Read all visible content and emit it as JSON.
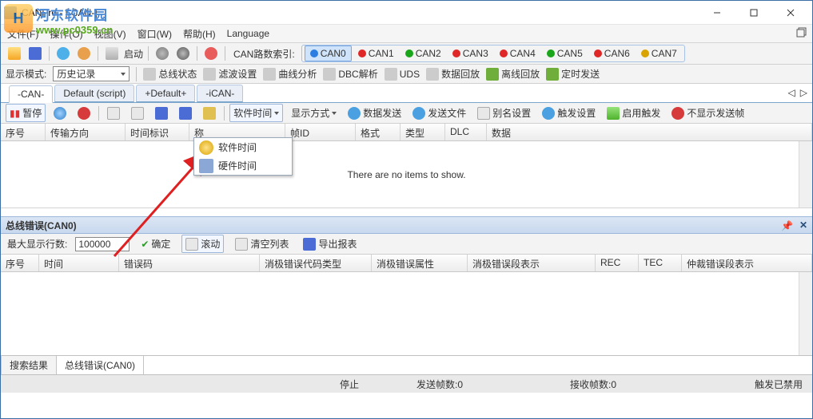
{
  "window": {
    "title": "CANPro - [-CAN-]"
  },
  "watermark": {
    "cn": "河东软件园",
    "url": "www.pc0359.cn",
    "logo_text": "H"
  },
  "menubar": [
    "文件(F)",
    "操作(O)",
    "视图(V)",
    "窗口(W)",
    "帮助(H)",
    "Language"
  ],
  "toolbar1": {
    "route_label": "CAN路数索引:",
    "routes": [
      {
        "label": "CAN0",
        "color": "#2a7de1",
        "sel": true
      },
      {
        "label": "CAN1",
        "color": "#e02727"
      },
      {
        "label": "CAN2",
        "color": "#1aa51a"
      },
      {
        "label": "CAN3",
        "color": "#e02727"
      },
      {
        "label": "CAN4",
        "color": "#e02727"
      },
      {
        "label": "CAN5",
        "color": "#1aa51a"
      },
      {
        "label": "CAN6",
        "color": "#e02727"
      },
      {
        "label": "CAN7",
        "color": "#d9a300"
      }
    ]
  },
  "toolbar2": {
    "mode_label": "显示模式:",
    "mode_value": "历史记录",
    "items": [
      "总线状态",
      "滤波设置",
      "曲线分析",
      "DBC解析",
      "UDS",
      "数据回放",
      "离线回放",
      "定时发送"
    ]
  },
  "tabs": [
    "-CAN-",
    "Default (script)",
    "+Default+",
    "-iCAN-"
  ],
  "toolbar3": {
    "pause": "暂停",
    "time_btn": "软件时间",
    "display_btn": "显示方式",
    "items": [
      "数据发送",
      "发送文件",
      "别名设置",
      "触发设置",
      "启用触发",
      "不显示发送帧"
    ]
  },
  "dropdown": {
    "i1": "软件时间",
    "i2": "硬件时间"
  },
  "thead": [
    "序号",
    "传输方向",
    "时间标识",
    "称",
    "帧ID",
    "格式",
    "类型",
    "DLC",
    "数据"
  ],
  "grid_empty": "There are no items to show.",
  "panel": {
    "title": "总线错误(CAN0)",
    "maxrows_label": "最大显示行数:",
    "maxrows_value": "100000",
    "ok": "确定",
    "scroll": "滚动",
    "clear": "清空列表",
    "export": "导出报表"
  },
  "err_head": [
    "序号",
    "时间",
    "错误码",
    "消极错误代码类型",
    "消极错误属性",
    "消极错误段表示",
    "REC",
    "TEC",
    "仲裁错误段表示"
  ],
  "bottom_tabs": [
    "搜索结果",
    "总线错误(CAN0)"
  ],
  "status": {
    "stop": "停止",
    "send": "发送帧数:0",
    "recv": "接收帧数:0",
    "trig": "触发已禁用"
  }
}
